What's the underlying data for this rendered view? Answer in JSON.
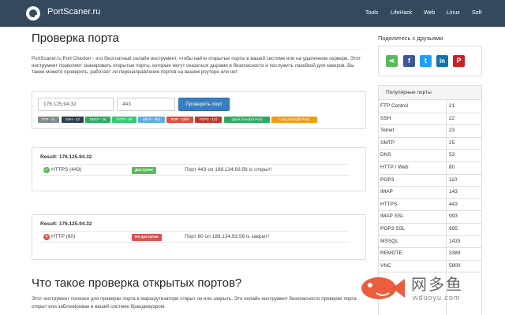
{
  "navbar": {
    "brand": "PortScaner.ru",
    "links": [
      "Tools",
      "LifeHack",
      "Web",
      "Linux",
      "Soft"
    ],
    "bg_color": "#34495e"
  },
  "main": {
    "title": "Проверка порта",
    "intro": "PortScaner.ru Port Checker - это бесплатный онлайн инструмент, чтобы найти открытые порты в вашей системе или на удаленном сервере. Этот инструмент позволяет сканировать открытые порты, которые могут оказаться дырами в безопасности и послужить лазейкой для хакеров. Вы также можете проверить, работает ли перенаправление портов на вашем роутере или нет",
    "checker": {
      "ip_value": "176.125.94.32",
      "port_value": "443",
      "submit_label": "Проверить порт",
      "accent_color": "#3a7ebd",
      "quick_buttons": [
        {
          "label": "FTP - 21",
          "color": "#7f8c8d"
        },
        {
          "label": "SSH - 22",
          "color": "#2c3e50"
        },
        {
          "label": "SMTP - 25",
          "color": "#27ae60"
        },
        {
          "label": "HTTP - 80",
          "color": "#2ecc71"
        },
        {
          "label": "IMAP - 993",
          "color": "#5dade2"
        },
        {
          "label": "RDP - 3389",
          "color": "#e74c3c"
        },
        {
          "label": "POP3 - 110",
          "color": "#c0392b"
        },
        {
          "label": "Quick Scan[15 Port]",
          "color": "#27ae60"
        },
        {
          "label": "Long Scan[36 Port]",
          "color": "#f39c12"
        }
      ]
    },
    "results": [
      {
        "title": "Result: 176.125.94.32",
        "service": "HTTPS (443)",
        "status_icon": "check-icon",
        "badge": "Доступен",
        "badge_color": "#5cb85c",
        "message": "Порт 443 on 188.134.93.56 is открыт!"
      },
      {
        "title": "Result: 176.125.94.32",
        "service": "HTTP (80)",
        "status_icon": "cross-icon",
        "badge": "Не доступен",
        "badge_color": "#d9534f",
        "message": "Порт 80 on 188.134.93.56 is закрыт!"
      }
    ],
    "section_title": "Что такое проверка открытых портов?",
    "section_text": "Этот инструмент полезен для проверки порта в маршрутизаторе открыт он или закрыть. Это онлайн инструмент безопасности проверки порта открыт или заблокирован в вашей системе брандмауэром."
  },
  "sidebar": {
    "share_title": "Поделитесь с друзьями",
    "share_buttons": [
      {
        "icon": "share-icon",
        "glyph": "⋖",
        "color": "#5cb85c"
      },
      {
        "icon": "facebook-icon",
        "glyph": "f",
        "color": "#3b5998"
      },
      {
        "icon": "twitter-icon",
        "glyph": "t",
        "color": "#1da1f2"
      },
      {
        "icon": "linkedin-icon",
        "glyph": "in",
        "color": "#0e76a8"
      },
      {
        "icon": "pinterest-icon",
        "glyph": "P",
        "color": "#cb2027"
      }
    ],
    "ports_title": "Популярные порты",
    "ports": [
      {
        "name": "FTP Control",
        "port": "21"
      },
      {
        "name": "SSH",
        "port": "22"
      },
      {
        "name": "Telnet",
        "port": "23"
      },
      {
        "name": "SMTP",
        "port": "25"
      },
      {
        "name": "DNS",
        "port": "53"
      },
      {
        "name": "HTTP / Web",
        "port": "80"
      },
      {
        "name": "POP3",
        "port": "110"
      },
      {
        "name": "IMAP",
        "port": "143"
      },
      {
        "name": "HTTPS",
        "port": "443"
      },
      {
        "name": "IMAP SSL",
        "port": "993"
      },
      {
        "name": "POP3 SSL",
        "port": "995"
      },
      {
        "name": "MSSQL",
        "port": "1433"
      },
      {
        "name": "REMOTE",
        "port": "3389"
      },
      {
        "name": "VNC",
        "port": "5900"
      }
    ]
  },
  "watermark": {
    "text": "网多鱼",
    "url": "wduoyu.com"
  }
}
